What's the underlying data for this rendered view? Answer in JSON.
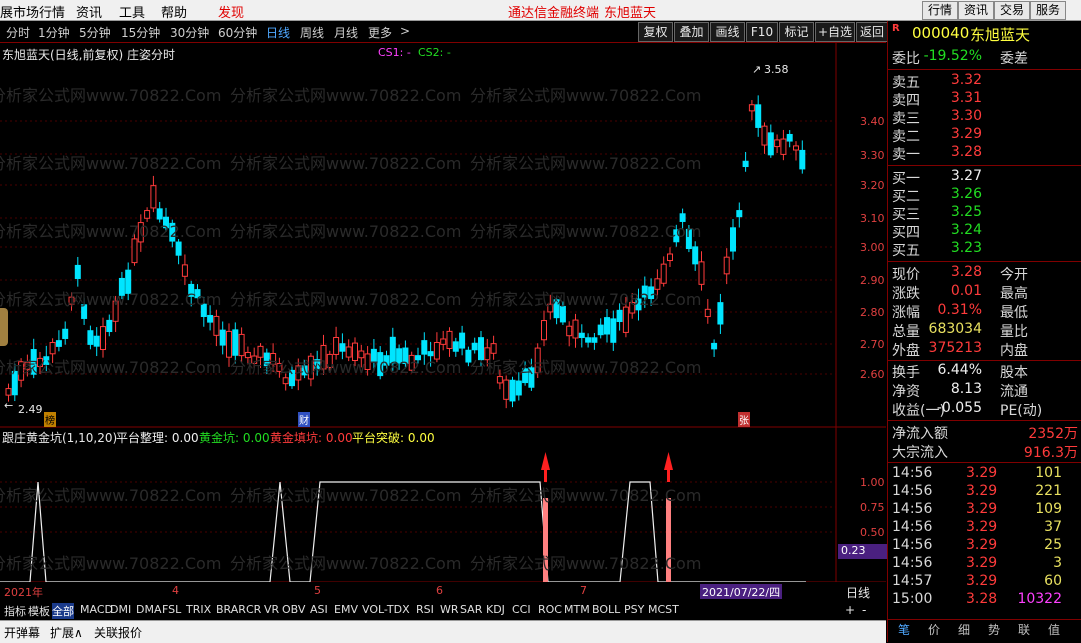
{
  "menu": {
    "items": [
      "展市场行情",
      "资讯",
      "工具",
      "帮助"
    ],
    "alert": "发现",
    "center_title": "通达信金融终端",
    "center_stock": "东旭蓝天",
    "right_buttons": [
      "行情",
      "资讯",
      "交易",
      "服务"
    ]
  },
  "periods": {
    "items": [
      "分时",
      "1分钟",
      "5分钟",
      "15分钟",
      "30分钟",
      "60分钟",
      "日线",
      "周线",
      "月线",
      "更多"
    ],
    "selected": "日线",
    "more_arrow": ">",
    "tools": [
      "复权",
      "叠加",
      "画线",
      "F10",
      "标记",
      "+自选",
      "返回"
    ]
  },
  "chart": {
    "title": "东旭蓝天(日线,前复权) 庄姿分时",
    "cs1": "CS1: -",
    "cs2": "CS2: -",
    "high_label": "3.58",
    "low_label": "2.49",
    "y_ticks": [
      "3.40",
      "3.30",
      "3.20",
      "3.10",
      "3.00",
      "2.90",
      "2.80",
      "2.70",
      "2.60"
    ],
    "markers": {
      "bang": "榜",
      "cai": "财",
      "zhang": "张"
    },
    "date_labels": [
      "2021年",
      "4",
      "5",
      "6",
      "7"
    ],
    "date_cursor": "2021/07/22/四",
    "corner_label": "2021年"
  },
  "indicator": {
    "title": "跟庄黄金坑(1,10,20)",
    "items": [
      {
        "label": "平台整理:",
        "value": "0.00",
        "color": "#f0f0f0"
      },
      {
        "label": "黄金坑:",
        "value": "0.00",
        "color": "#22dd22"
      },
      {
        "label": "黄金填坑:",
        "value": "0.00",
        "color": "#ff3b3b"
      },
      {
        "label": "平台突破:",
        "value": "0.00",
        "color": "#ffff40"
      }
    ],
    "y_ticks": [
      "1.00",
      "0.75",
      "0.50"
    ],
    "current_value": "0.23"
  },
  "quote": {
    "badge": "R",
    "code": "000040",
    "name": "东旭蓝天",
    "weibi_label": "委比",
    "weibi_value": "-19.52%",
    "weicha_label": "委差",
    "asks": [
      {
        "label": "卖五",
        "price": "3.32",
        "vol": ""
      },
      {
        "label": "卖四",
        "price": "3.31",
        "vol": ""
      },
      {
        "label": "卖三",
        "price": "3.30",
        "vol": ""
      },
      {
        "label": "卖二",
        "price": "3.29",
        "vol": ""
      },
      {
        "label": "卖一",
        "price": "3.28",
        "vol": ""
      }
    ],
    "bids": [
      {
        "label": "买一",
        "price": "3.27",
        "vol": ""
      },
      {
        "label": "买二",
        "price": "3.26",
        "vol": ""
      },
      {
        "label": "买三",
        "price": "3.25",
        "vol": ""
      },
      {
        "label": "买四",
        "price": "3.24",
        "vol": ""
      },
      {
        "label": "买五",
        "price": "3.23",
        "vol": ""
      }
    ],
    "stats": [
      {
        "label": "现价",
        "value": "3.28",
        "color": "red",
        "label2": "今开"
      },
      {
        "label": "涨跌",
        "value": "0.01",
        "color": "red",
        "label2": "最高"
      },
      {
        "label": "涨幅",
        "value": "0.31%",
        "color": "red",
        "label2": "最低"
      },
      {
        "label": "总量",
        "value": "683034",
        "color": "yellow",
        "label2": "量比"
      },
      {
        "label": "外盘",
        "value": "375213",
        "color": "red",
        "label2": "内盘"
      }
    ],
    "stats2": [
      {
        "label": "换手",
        "value": "6.44%",
        "label2": "股本"
      },
      {
        "label": "净资",
        "value": "8.13",
        "label2": "流通"
      },
      {
        "label": "收益(一)",
        "value": "-0.055",
        "label2": "PE(动)"
      }
    ],
    "flow": [
      {
        "label": "净流入额",
        "value": "2352万"
      },
      {
        "label": "大宗流入",
        "value": "916.3万"
      }
    ],
    "ticks": [
      {
        "time": "14:56",
        "price": "3.29",
        "vol": "101",
        "vc": "yellow"
      },
      {
        "time": "14:56",
        "price": "3.29",
        "vol": "221",
        "vc": "yellow"
      },
      {
        "time": "14:56",
        "price": "3.29",
        "vol": "109",
        "vc": "yellow"
      },
      {
        "time": "14:56",
        "price": "3.29",
        "vol": "37",
        "vc": "yellow"
      },
      {
        "time": "14:56",
        "price": "3.29",
        "vol": "25",
        "vc": "yellow"
      },
      {
        "time": "14:56",
        "price": "3.29",
        "vol": "3",
        "vc": "yellow"
      },
      {
        "time": "14:57",
        "price": "3.29",
        "vol": "60",
        "vc": "yellow"
      },
      {
        "time": "15:00",
        "price": "3.28",
        "vol": "10322",
        "vc": "mag"
      }
    ],
    "bottom_tabs": [
      "笔",
      "价",
      "细",
      "势",
      "联",
      "值"
    ]
  },
  "tabs": {
    "items": [
      "指标",
      "模板",
      "全部",
      "MACD",
      "DMI",
      "DMA",
      "FSL",
      "TRIX",
      "BRAR",
      "CR",
      "VR",
      "OBV",
      "ASI",
      "EMV",
      "VOL-TDX",
      "RSI",
      "WR",
      "SAR",
      "KDJ",
      "CCI",
      "ROC",
      "MTM",
      "BOLL",
      "PSY",
      "MCST"
    ],
    "selected": "全部",
    "right_label": "日线",
    "plus": "+",
    "minus": "-"
  },
  "status": {
    "items": [
      "开弹幕",
      "扩展∧",
      "关联报价"
    ]
  },
  "watermark": "分析家公式网www.70822.Com"
}
